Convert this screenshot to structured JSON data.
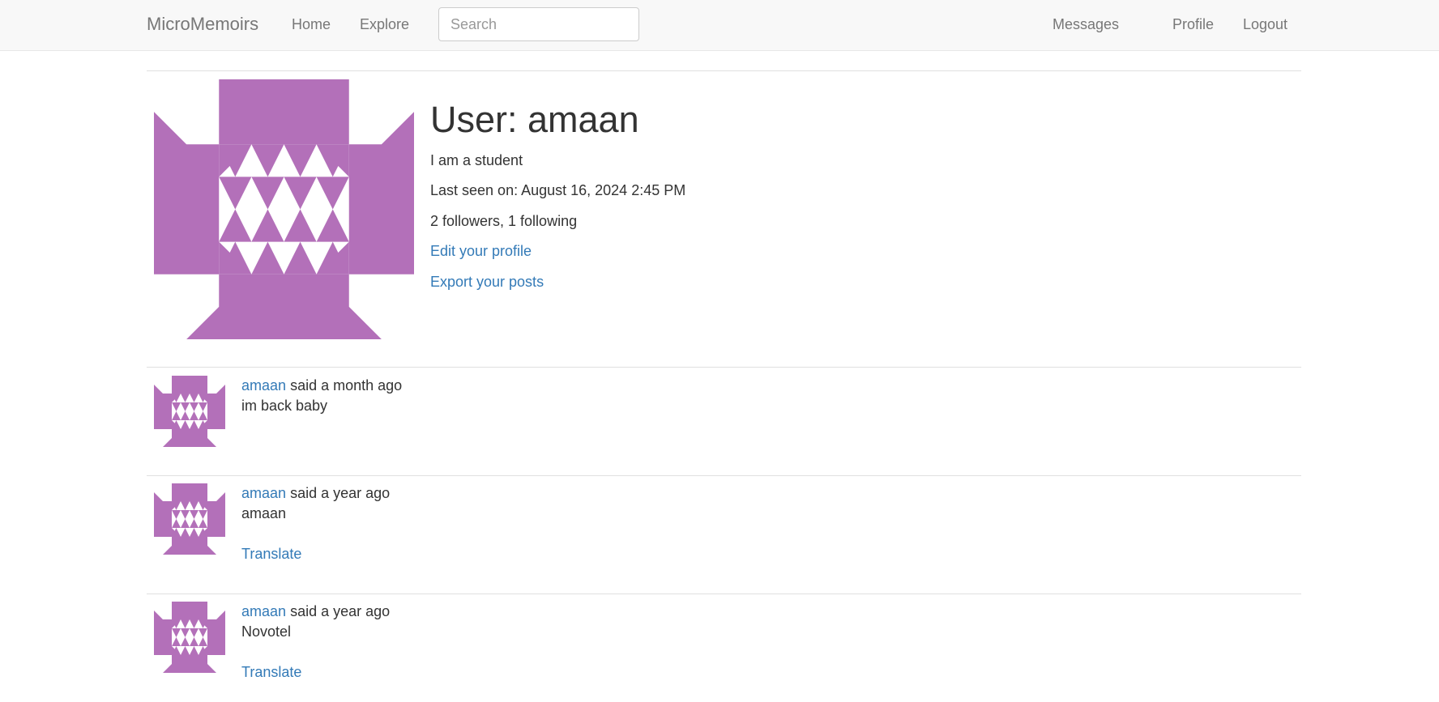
{
  "navbar": {
    "brand": "MicroMemoirs",
    "home": "Home",
    "explore": "Explore",
    "search_placeholder": "Search",
    "search_value": "",
    "messages": "Messages",
    "profile": "Profile",
    "logout": "Logout"
  },
  "profile": {
    "title": "User: amaan",
    "about_me": "I am a student",
    "last_seen": "Last seen on: August 16, 2024 2:45 PM",
    "follow_stats": "2 followers, 1 following",
    "edit_profile_link": "Edit your profile",
    "export_posts_link": "Export your posts",
    "avatar_icon": "identicon-avatar-icon"
  },
  "posts": [
    {
      "author": "amaan",
      "time": "said a month ago",
      "body": "im back baby",
      "translate": ""
    },
    {
      "author": "amaan",
      "time": "said a year ago",
      "body": "amaan",
      "translate": "Translate"
    },
    {
      "author": "amaan",
      "time": "said a year ago",
      "body": "Novotel",
      "translate": "Translate"
    }
  ],
  "colors": {
    "avatar_purple": "#b370b9",
    "link": "#337ab7",
    "navbar_bg": "#f8f8f8",
    "nav_text": "#777777",
    "text": "#333333"
  }
}
